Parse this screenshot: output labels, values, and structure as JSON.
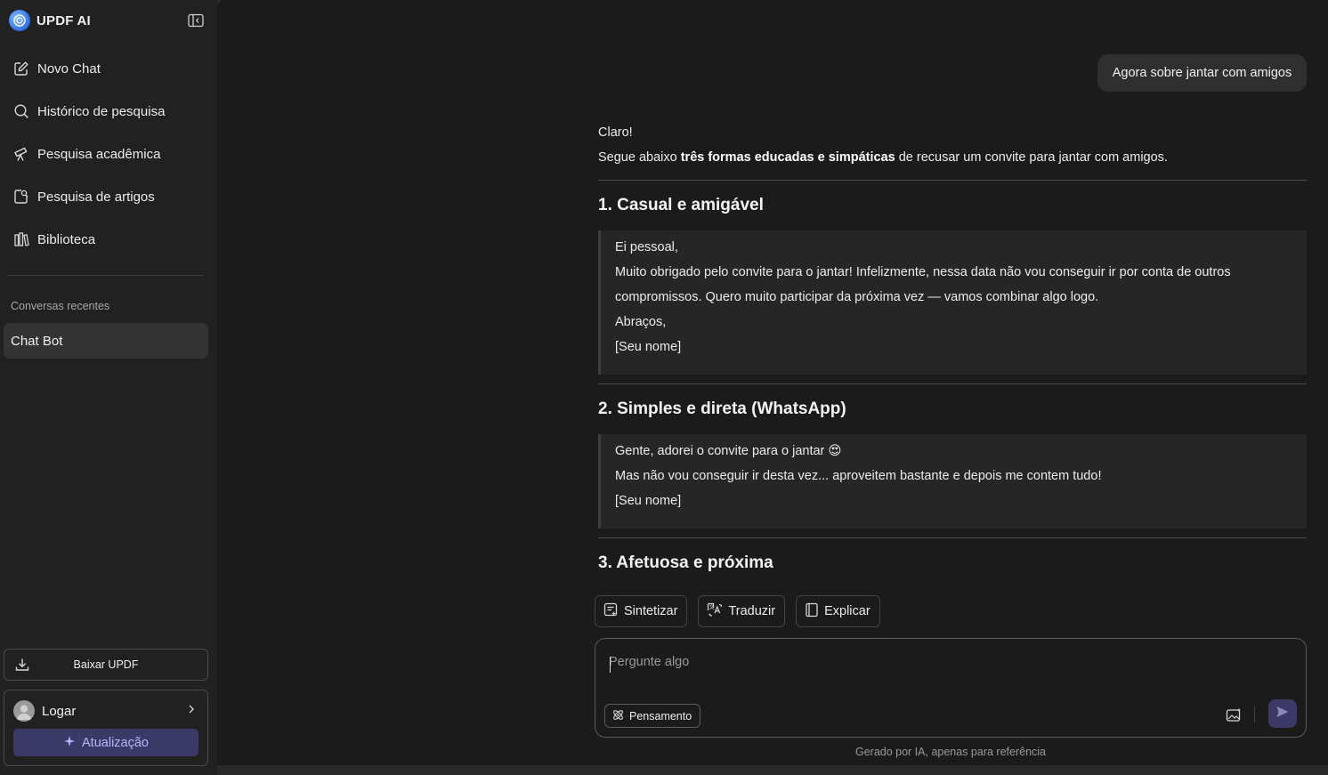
{
  "brand": {
    "name": "UPDF AI"
  },
  "sidebar": {
    "items": [
      {
        "label": "Novo Chat",
        "icon": "edit-icon"
      },
      {
        "label": "Histórico de pesquisa",
        "icon": "search-icon"
      },
      {
        "label": "Pesquisa acadêmica",
        "icon": "telescope-icon"
      },
      {
        "label": "Pesquisa de artigos",
        "icon": "doc-search-icon"
      },
      {
        "label": "Biblioteca",
        "icon": "library-icon"
      }
    ],
    "recent_title": "Conversas recentes",
    "recent_items": [
      {
        "label": "Chat Bot"
      }
    ],
    "download_label": "Baixar UPDF",
    "login_label": "Logar",
    "upgrade_label": "Atualização"
  },
  "chat": {
    "user_message": "Agora sobre jantar com amigos",
    "intro_line1": "Claro!",
    "intro_pre": "Segue abaixo ",
    "intro_bold": "três formas educadas e simpáticas",
    "intro_post": " de recusar um convite para jantar com amigos.",
    "section1": {
      "title": "1. Casual e amigável",
      "lines": [
        "Ei pessoal,",
        "Muito obrigado pelo convite para o jantar! Infelizmente, nessa data não vou conseguir ir por conta de outros",
        "compromissos. Quero muito participar da próxima vez — vamos combinar algo logo.",
        "Abraços,",
        "[Seu nome]"
      ]
    },
    "section2": {
      "title": "2. Simples e direta (WhatsApp)",
      "lines": [
        "Gente, adorei o convite para o jantar 😍",
        "Mas não vou conseguir ir desta vez... aproveitem bastante e depois me contem tudo!",
        "[Seu nome]"
      ]
    },
    "section3": {
      "title": "3. Afetuosa e próxima"
    }
  },
  "actions": {
    "summarize": "Sintetizar",
    "translate": "Traduzir",
    "explain": "Explicar"
  },
  "composer": {
    "placeholder": "Pergunte algo",
    "thinking_label": "Pensamento"
  },
  "footer_note": "Gerado por IA, apenas para referência",
  "colors": {
    "sidebar_bg": "#212121",
    "main_bg": "#1b1b1b",
    "accent": "#3b3a66",
    "accent_text": "#b9b4ff"
  }
}
